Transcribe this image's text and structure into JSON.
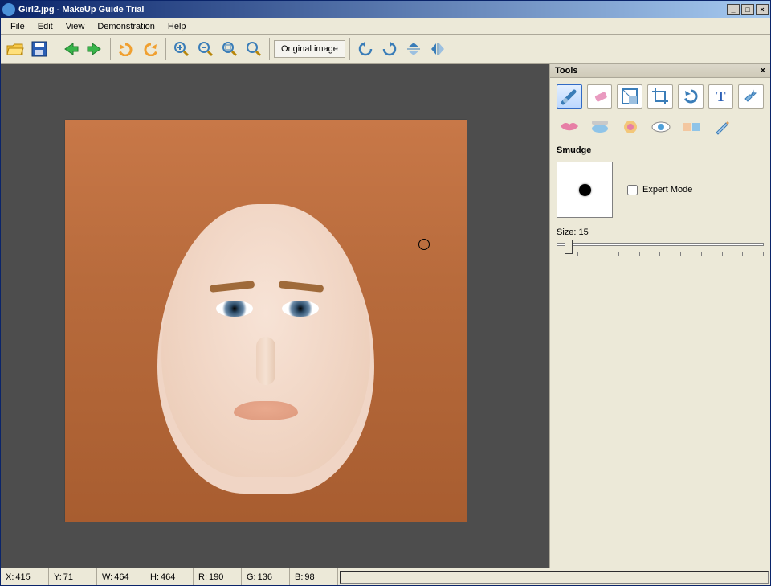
{
  "window": {
    "title": "Girl2.jpg - MakeUp Guide Trial"
  },
  "menu": {
    "items": [
      "File",
      "Edit",
      "View",
      "Demonstration",
      "Help"
    ]
  },
  "toolbar": {
    "original_image_label": "Original image",
    "icons": {
      "open": "open-icon",
      "save": "save-icon",
      "back": "back-icon",
      "forward": "forward-icon",
      "undo": "undo-icon",
      "redo": "redo-icon",
      "zoom_in": "zoom-in-icon",
      "zoom_out": "zoom-out-icon",
      "zoom_fit": "zoom-fit-icon",
      "zoom_100": "zoom-100-icon",
      "rotate_ccw": "rotate-ccw-icon",
      "rotate_cw": "rotate-cw-icon",
      "flip_v": "flip-vertical-icon",
      "flip_h": "flip-horizontal-icon"
    }
  },
  "tools_panel": {
    "title": "Tools",
    "current_tool_label": "Smudge",
    "expert_mode_label": "Expert Mode",
    "expert_mode_checked": false,
    "size_label": "Size: 15",
    "size_value": 15,
    "row1_icons": [
      "smudge-tool-icon",
      "eraser-tool-icon",
      "resize-tool-icon",
      "crop-tool-icon",
      "undo-tool-icon",
      "text-tool-icon",
      "settings-tool-icon"
    ],
    "row2_icons": [
      "lips-tool-icon",
      "eyeshadow-tool-icon",
      "blush-tool-icon",
      "eyecolor-tool-icon",
      "skin-tool-icon",
      "pencil-tool-icon"
    ]
  },
  "status": {
    "x_label": "X:",
    "x_value": "415",
    "y_label": "Y:",
    "y_value": "71",
    "w_label": "W:",
    "w_value": "464",
    "h_label": "H:",
    "h_value": "464",
    "r_label": "R:",
    "r_value": "190",
    "g_label": "G:",
    "g_value": "136",
    "b_label": "B:",
    "b_value": "98"
  },
  "colors": {
    "accent": "#316ac5",
    "panel": "#ece9d8",
    "canvas_bg": "#4d4d4d"
  }
}
